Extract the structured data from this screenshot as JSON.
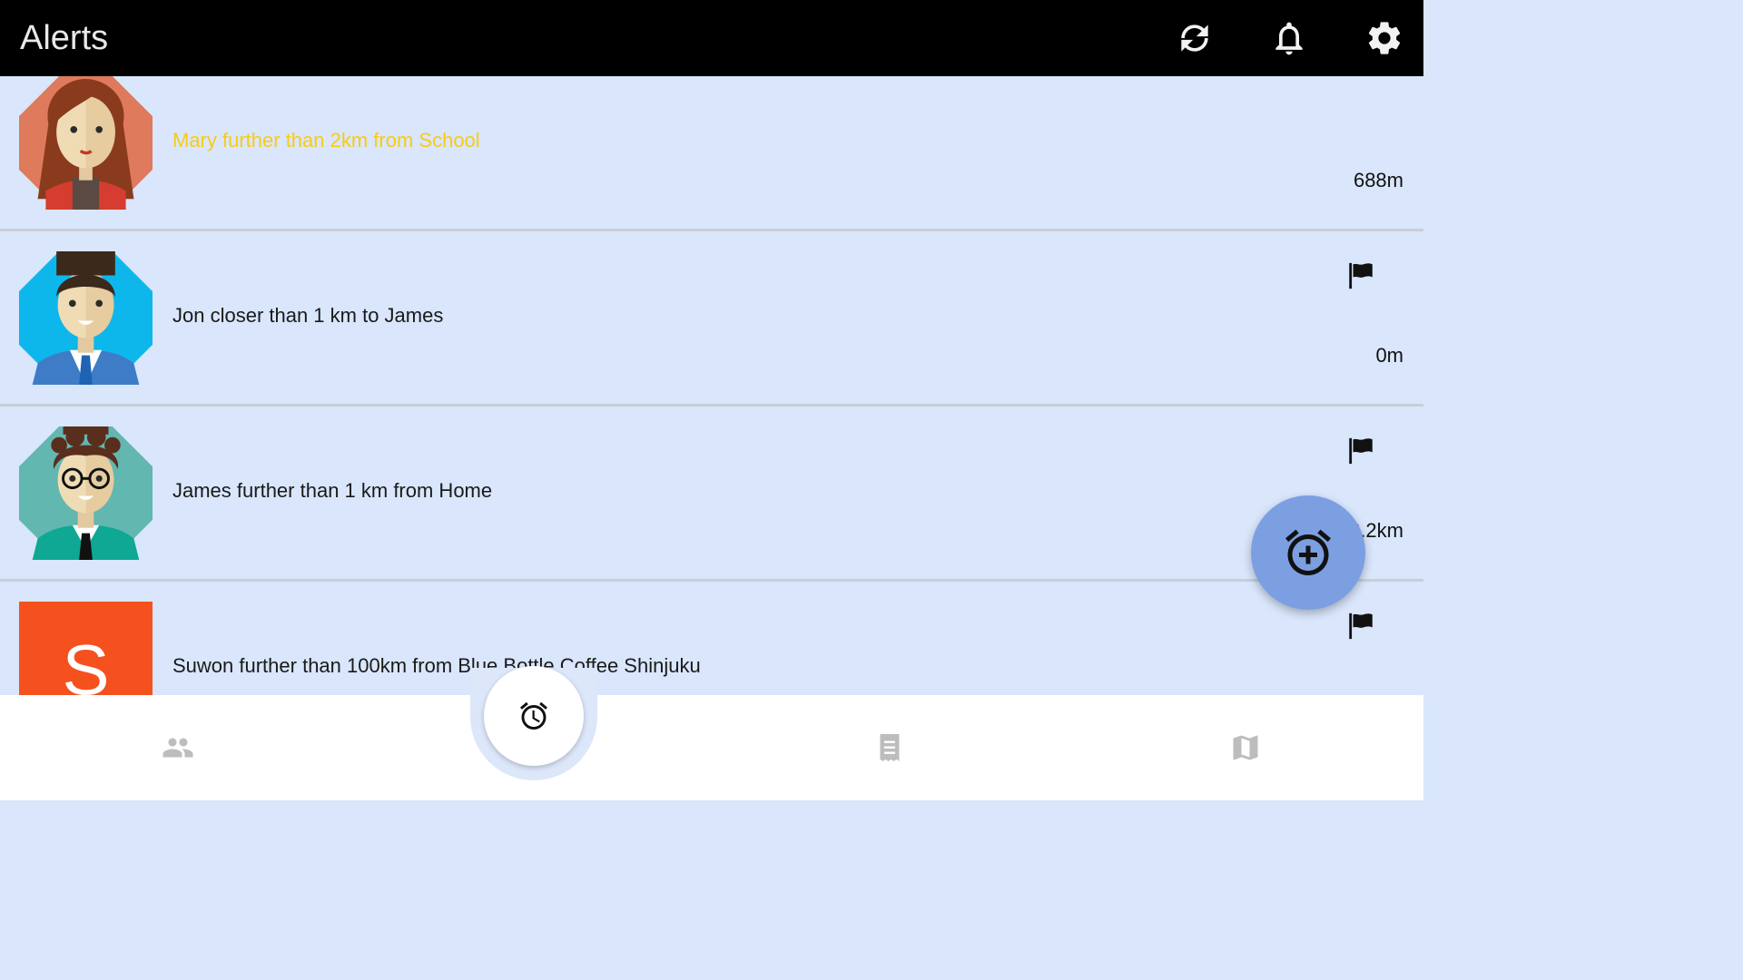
{
  "header": {
    "title": "Alerts",
    "icons": [
      "refresh-icon",
      "bell-icon",
      "gear-icon"
    ]
  },
  "alerts": [
    {
      "avatar": "woman-avatar",
      "text": "Mary further than 2km from School",
      "distance": "688m",
      "text_color": "#f7cb16",
      "flag": false
    },
    {
      "avatar": "man-avatar",
      "text": "Jon closer than 1 km to James",
      "distance": "0m",
      "text_color": "#1a1a1a",
      "flag": true
    },
    {
      "avatar": "man-glasses-avatar",
      "text": "James further than 1 km from Home",
      "distance": "2.2km",
      "text_color": "#1a1a1a",
      "flag": true
    },
    {
      "avatar": "letter-avatar",
      "letter": "S",
      "text": "Suwon further than 100km from Blue Bottle Coffee Shinjuku",
      "distance": "",
      "text_color": "#1a1a1a",
      "flag": true
    }
  ],
  "fab": {
    "icon": "add-alarm-icon"
  },
  "bottom_nav": {
    "items": [
      "people-icon",
      "alarm-icon",
      "list-icon",
      "map-icon"
    ],
    "selected": "alarm-icon"
  },
  "colors": {
    "topbar": "#000000",
    "list_background": "#d9e6fb",
    "fab": "#7c9fe2",
    "letter_avatar": "#f5511e",
    "highlight_text": "#f7cb16"
  }
}
